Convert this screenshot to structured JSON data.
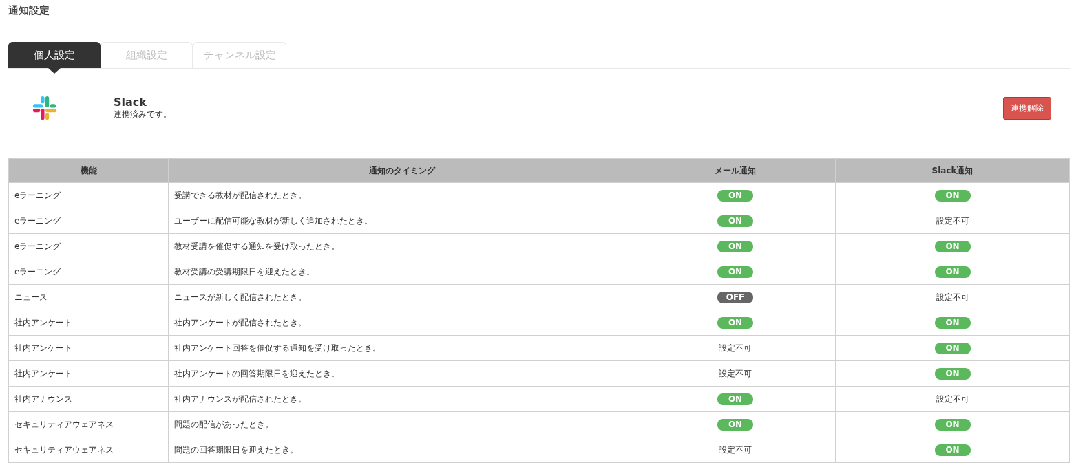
{
  "page_title": "通知設定",
  "tabs": [
    {
      "label": "個人設定",
      "selected": true
    },
    {
      "label": "組織設定",
      "selected": false
    },
    {
      "label": "チャンネル設定",
      "selected": false
    }
  ],
  "integration": {
    "name": "Slack",
    "status": "連携済みです。",
    "button": "連携解除"
  },
  "table": {
    "columns": [
      "機能",
      "通知のタイミング",
      "メール通知",
      "Slack通知"
    ],
    "rows": [
      {
        "feature": "eラーニング",
        "timing": "受講できる教材が配信されたとき。",
        "mail": {
          "kind": "toggle",
          "on": true,
          "label": "ON"
        },
        "slack": {
          "kind": "toggle",
          "on": true,
          "label": "ON"
        }
      },
      {
        "feature": "eラーニング",
        "timing": "ユーザーに配信可能な教材が新しく追加されたとき。",
        "mail": {
          "kind": "toggle",
          "on": true,
          "label": "ON"
        },
        "slack": {
          "kind": "text",
          "text": "設定不可"
        }
      },
      {
        "feature": "eラーニング",
        "timing": "教材受講を催促する通知を受け取ったとき。",
        "mail": {
          "kind": "toggle",
          "on": true,
          "label": "ON"
        },
        "slack": {
          "kind": "toggle",
          "on": true,
          "label": "ON"
        }
      },
      {
        "feature": "eラーニング",
        "timing": "教材受講の受講期限日を迎えたとき。",
        "mail": {
          "kind": "toggle",
          "on": true,
          "label": "ON"
        },
        "slack": {
          "kind": "toggle",
          "on": true,
          "label": "ON"
        }
      },
      {
        "feature": "ニュース",
        "timing": "ニュースが新しく配信されたとき。",
        "mail": {
          "kind": "toggle",
          "on": false,
          "label": "OFF"
        },
        "slack": {
          "kind": "text",
          "text": "設定不可"
        }
      },
      {
        "feature": "社内アンケート",
        "timing": "社内アンケートが配信されたとき。",
        "mail": {
          "kind": "toggle",
          "on": true,
          "label": "ON"
        },
        "slack": {
          "kind": "toggle",
          "on": true,
          "label": "ON"
        }
      },
      {
        "feature": "社内アンケート",
        "timing": "社内アンケート回答を催促する通知を受け取ったとき。",
        "mail": {
          "kind": "text",
          "text": "設定不可"
        },
        "slack": {
          "kind": "toggle",
          "on": true,
          "label": "ON"
        }
      },
      {
        "feature": "社内アンケート",
        "timing": "社内アンケートの回答期限日を迎えたとき。",
        "mail": {
          "kind": "text",
          "text": "設定不可"
        },
        "slack": {
          "kind": "toggle",
          "on": true,
          "label": "ON"
        }
      },
      {
        "feature": "社内アナウンス",
        "timing": "社内アナウンスが配信されたとき。",
        "mail": {
          "kind": "toggle",
          "on": true,
          "label": "ON"
        },
        "slack": {
          "kind": "text",
          "text": "設定不可"
        }
      },
      {
        "feature": "セキュリティアウェアネス",
        "timing": "問題の配信があったとき。",
        "mail": {
          "kind": "toggle",
          "on": true,
          "label": "ON"
        },
        "slack": {
          "kind": "toggle",
          "on": true,
          "label": "ON"
        }
      },
      {
        "feature": "セキュリティアウェアネス",
        "timing": "問題の回答期限日を迎えたとき。",
        "mail": {
          "kind": "text",
          "text": "設定不可"
        },
        "slack": {
          "kind": "toggle",
          "on": true,
          "label": "ON"
        }
      }
    ]
  }
}
